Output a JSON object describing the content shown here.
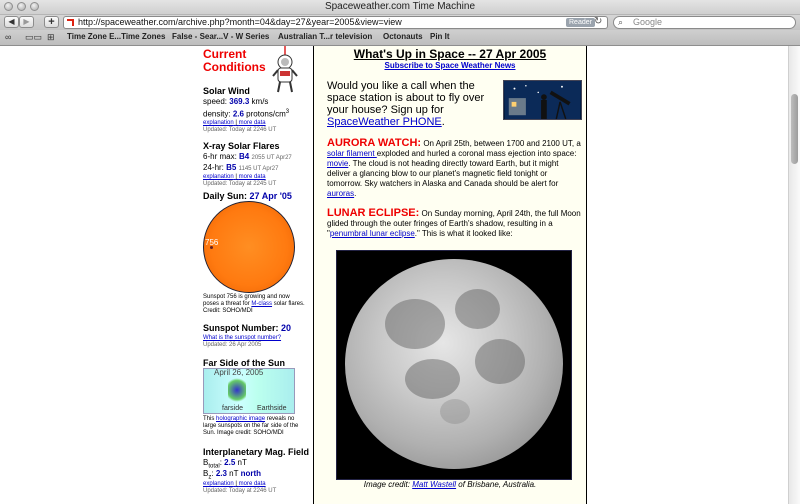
{
  "window": {
    "title": "Spaceweather.com Time Machine"
  },
  "toolbar": {
    "back": "◀",
    "forward": "▶",
    "add": "+",
    "url": "http://spaceweather.com/archive.php?month=04&day=27&year=2005&view=view",
    "reader": "Reader",
    "reload": "↻",
    "search_placeholder": "Google"
  },
  "bookmarks": [
    "Time Zone E...Time Zones",
    "False - Sear...V - W Series",
    "Australian T...r television",
    "Octonauts",
    "Pin It"
  ],
  "left": {
    "title_line1": "Current",
    "title_line2": "Conditions",
    "solar_wind": {
      "heading": "Solar Wind",
      "speed_label": "speed:",
      "speed_value": "369.3",
      "speed_unit": "km/s",
      "density_label": "density:",
      "density_value": "2.6",
      "density_unit": "protons/cm",
      "density_sup": "3",
      "link_explanation": "explanation",
      "sep": "|",
      "link_more": "more data",
      "updated": "Updated: Today at 2246 UT"
    },
    "xray": {
      "heading": "X-ray Solar Flares",
      "six_label": "6-hr max:",
      "six_value": "B4",
      "six_time": "2055 UT Apr27",
      "day_label": "24-hr:",
      "day_value": "B5",
      "day_time": "1145 UT Apr27",
      "link_explanation": "explanation",
      "sep": "|",
      "link_more": "more data",
      "updated": "Updated: Today at 2245 UT"
    },
    "daily_sun": {
      "heading_prefix": "Daily Sun:",
      "heading_date": "27 Apr '05",
      "spot_label": "756",
      "caption_pre": "Sunspot 756 is growing and now poses a threat for ",
      "caption_link": "M-class",
      "caption_post": " solar flares. Credit: SOHO/MDI"
    },
    "sunspot": {
      "heading": "Sunspot Number:",
      "value": "20",
      "link": "What is the sunspot number?",
      "updated": "Updated: 26 Apr 2005"
    },
    "far_side": {
      "heading": "Far Side of the Sun",
      "img_date": "April 26, 2005",
      "img_farside": "farside",
      "img_earthside": "Earthside",
      "caption_pre": "This ",
      "caption_link": "holographic image",
      "caption_post": " reveals no large sunspots on the far side of the Sun. Image credit: SOHO/MDI"
    },
    "imf": {
      "heading": "Interplanetary Mag. Field",
      "btotal_label": "B",
      "btotal_sub": "total",
      "btotal_sep": ":",
      "btotal_value": "2.5",
      "btotal_unit": "nT",
      "bz_label": "B",
      "bz_sub": "z",
      "bz_sep": ":",
      "bz_value": "2.3",
      "bz_unit": "nT",
      "bz_dir": "north",
      "link_explanation": "explanation",
      "sep": "|",
      "link_more": "more data",
      "updated": "Updated: Today at 2246 UT"
    }
  },
  "main": {
    "title": "What's Up in Space -- 27 Apr 2005",
    "subscribe": "Subscribe to Space Weather News",
    "call_text": "Would you like a call when the space station is about to fly over your house? Sign up for ",
    "call_link": "SpaceWeather PHONE",
    "call_end": ".",
    "aurora_head": "AURORA WATCH:",
    "aurora_1": " On April 25th, between 1700 and 2100 UT, a ",
    "aurora_link1": "solar filament ",
    "aurora_2": "exploded and hurled a coronal mass ejection into space: ",
    "aurora_link2": "movie",
    "aurora_3": ". The cloud is not heading directly toward Earth, but it might deliver a glancing blow to our planet's magnetic field tonight or tomorrow. Sky watchers in Alaska and Canada should be alert for ",
    "aurora_link3": "auroras",
    "aurora_4": ".",
    "lunar_head": "LUNAR ECLIPSE:",
    "lunar_1": " On Sunday morning, April 24th, the full Moon glided through the outer fringes of Earth's shadow, resulting in a \"",
    "lunar_link": "penumbral lunar eclipse",
    "lunar_2": ".\" This is what it looked like:",
    "credit_pre": "Image credit: ",
    "credit_link": "Matt Wastell",
    "credit_post": " of Brisbane, Australia."
  }
}
